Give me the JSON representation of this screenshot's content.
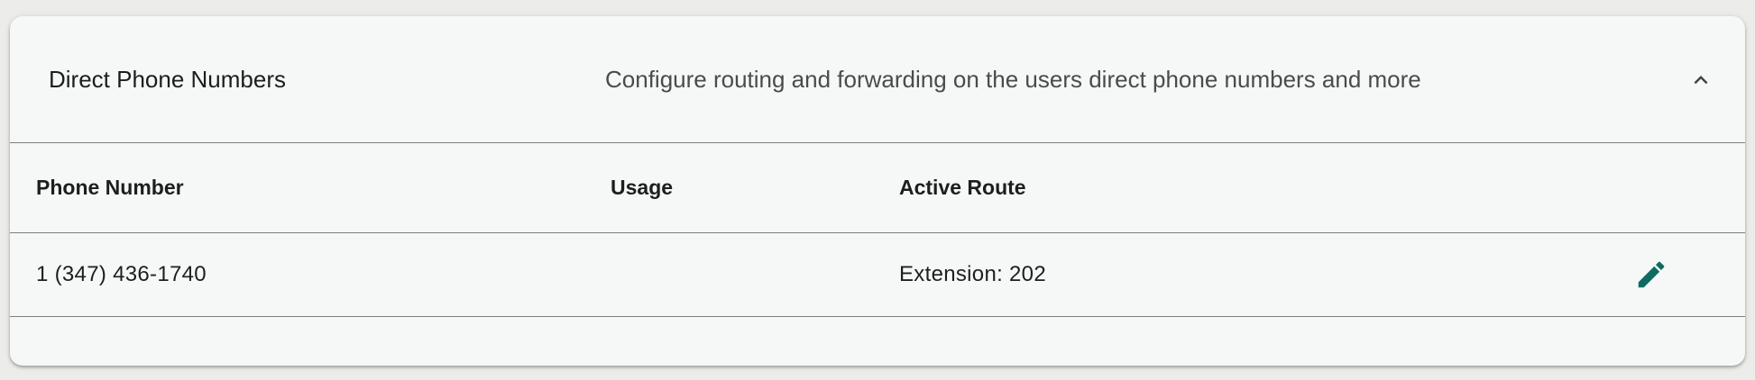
{
  "panel": {
    "title": "Direct Phone Numbers",
    "description": "Configure routing and forwarding on the users direct phone numbers and more",
    "expanded": true,
    "collapse_icon": "chevron-up-icon"
  },
  "table": {
    "columns": {
      "phone_number": "Phone Number",
      "usage": "Usage",
      "active_route": "Active Route"
    },
    "rows": [
      {
        "phone_number": "1 (347) 436-1740",
        "usage": "",
        "active_route": "Extension: 202",
        "action_icon": "pencil-icon"
      }
    ]
  },
  "colors": {
    "accent": "#0f6b62",
    "panel_background": "#f6f8f7",
    "page_background": "#ececea"
  }
}
